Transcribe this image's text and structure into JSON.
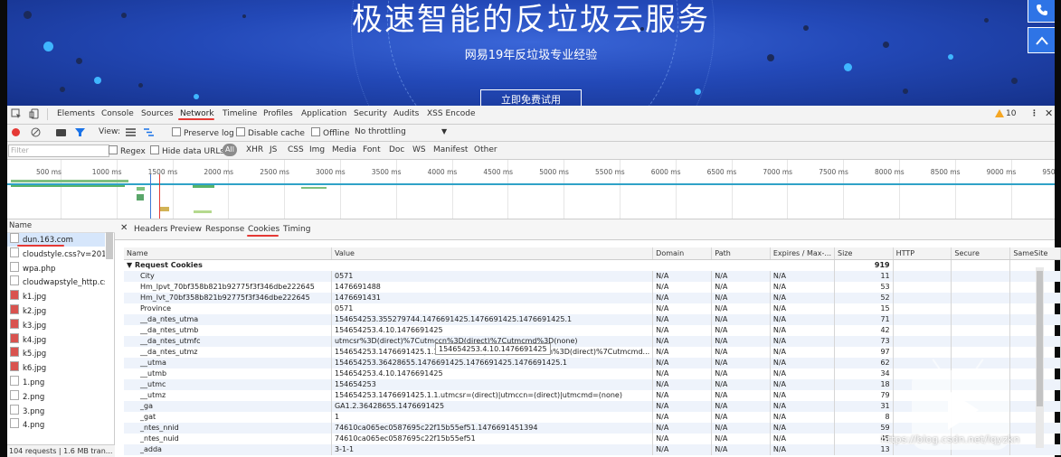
{
  "banner": {
    "title": "极速智能的反垃圾云服务",
    "subtitle": "网易19年反垃圾专业经验",
    "cta": "立即免费试用"
  },
  "devtools": {
    "tabs": [
      "Elements",
      "Console",
      "Sources",
      "Network",
      "Timeline",
      "Profiles",
      "Application",
      "Security",
      "Audits",
      "XSS Encode"
    ],
    "active_tab": "Network",
    "warning_count": "10",
    "toolbar": {
      "view_label": "View:",
      "preserve_log": "Preserve log",
      "disable_cache": "Disable cache",
      "offline": "Offline",
      "throttling": "No throttling"
    },
    "filter": {
      "placeholder": "Filter",
      "regex": "Regex",
      "hide_data_urls": "Hide data URLs",
      "types": [
        "All",
        "XHR",
        "JS",
        "CSS",
        "Img",
        "Media",
        "Font",
        "Doc",
        "WS",
        "Manifest",
        "Other"
      ]
    },
    "timeline_ticks": [
      "500 ms",
      "1000 ms",
      "1500 ms",
      "2000 ms",
      "2500 ms",
      "3000 ms",
      "3500 ms",
      "4000 ms",
      "4500 ms",
      "5000 ms",
      "5500 ms",
      "6000 ms",
      "6500 ms",
      "7000 ms",
      "7500 ms",
      "8000 ms",
      "8500 ms",
      "9000 ms",
      "950"
    ],
    "requests_header": "Name",
    "requests": [
      "dun.163.com",
      "cloudstyle.css?v=2016...",
      "wpa.php",
      "cloudwapstyle_http.css",
      "k1.jpg",
      "k2.jpg",
      "k3.jpg",
      "k4.jpg",
      "k5.jpg",
      "k6.jpg",
      "1.png",
      "2.png",
      "3.png",
      "4.png"
    ],
    "status_bar": "104 requests | 1.6 MB tran...",
    "detail_tabs": [
      "Headers",
      "Preview",
      "Response",
      "Cookies",
      "Timing"
    ],
    "active_detail_tab": "Cookies",
    "cookie_columns": [
      "Name",
      "Value",
      "Domain",
      "Path",
      "Expires / Max-...",
      "Size",
      "HTTP",
      "Secure",
      "SameSite"
    ],
    "cookie_group": "Request Cookies",
    "cookie_group_size": "919",
    "cookies": [
      {
        "name": "City",
        "value": "0571",
        "domain": "N/A",
        "path": "N/A",
        "expires": "N/A",
        "size": "11"
      },
      {
        "name": "Hm_lpvt_70bf358b821b92775f3f346dbe222645",
        "value": "1476691488",
        "domain": "N/A",
        "path": "N/A",
        "expires": "N/A",
        "size": "53"
      },
      {
        "name": "Hm_lvt_70bf358b821b92775f3f346dbe222645",
        "value": "1476691431",
        "domain": "N/A",
        "path": "N/A",
        "expires": "N/A",
        "size": "52"
      },
      {
        "name": "Province",
        "value": "0571",
        "domain": "N/A",
        "path": "N/A",
        "expires": "N/A",
        "size": "15"
      },
      {
        "name": "__da_ntes_utma",
        "value": "154654253.355279744.1476691425.1476691425.1476691425.1",
        "domain": "N/A",
        "path": "N/A",
        "expires": "N/A",
        "size": "71"
      },
      {
        "name": "__da_ntes_utmb",
        "value": "154654253.4.10.1476691425",
        "domain": "N/A",
        "path": "N/A",
        "expires": "N/A",
        "size": "42"
      },
      {
        "name": "__da_ntes_utmfc",
        "value": "utmcsr%3D(direct)%7Cutmccn%3D(direct)%7Cutmcmd%3D(none)",
        "domain": "N/A",
        "path": "N/A",
        "expires": "N/A",
        "size": "73"
      },
      {
        "name": "__da_ntes_utmz",
        "value": "154654253.1476691425.1.1.utmcsr%3D(direct)%7Cutmccn%3D(direct)%7Cutmcmd...",
        "domain": "N/A",
        "path": "N/A",
        "expires": "N/A",
        "size": "97"
      },
      {
        "name": "__utma",
        "value": "154654253.36428655.1476691425.1476691425.1476691425.1",
        "domain": "N/A",
        "path": "N/A",
        "expires": "N/A",
        "size": "62"
      },
      {
        "name": "__utmb",
        "value": "154654253.4.10.1476691425",
        "domain": "N/A",
        "path": "N/A",
        "expires": "N/A",
        "size": "34"
      },
      {
        "name": "__utmc",
        "value": "154654253",
        "domain": "N/A",
        "path": "N/A",
        "expires": "N/A",
        "size": "18"
      },
      {
        "name": "__utmz",
        "value": "154654253.1476691425.1.1.utmcsr=(direct)|utmccn=(direct)|utmcmd=(none)",
        "domain": "N/A",
        "path": "N/A",
        "expires": "N/A",
        "size": "79"
      },
      {
        "name": "_ga",
        "value": "GA1.2.36428655.1476691425",
        "domain": "N/A",
        "path": "N/A",
        "expires": "N/A",
        "size": "31"
      },
      {
        "name": "_gat",
        "value": "1",
        "domain": "N/A",
        "path": "N/A",
        "expires": "N/A",
        "size": "8"
      },
      {
        "name": "_ntes_nnid",
        "value": "74610ca065ec0587695c22f15b55ef51.1476691451394",
        "domain": "N/A",
        "path": "N/A",
        "expires": "N/A",
        "size": "59"
      },
      {
        "name": "_ntes_nuid",
        "value": "74610ca065ec0587695c22f15b55ef51",
        "domain": "N/A",
        "path": "N/A",
        "expires": "N/A",
        "size": "45"
      },
      {
        "name": "_adda",
        "value": "3-1-1",
        "domain": "N/A",
        "path": "N/A",
        "expires": "N/A",
        "size": "13"
      }
    ],
    "tooltip": "154654253.4.10.1476691425"
  },
  "watermark": "https://blog.csdn.net/lqyzkn",
  "colors": {
    "banner": "#2349b8",
    "accent_red": "#e53935",
    "selection": "#d6e6fb",
    "alt_row": "#eef3fb"
  }
}
